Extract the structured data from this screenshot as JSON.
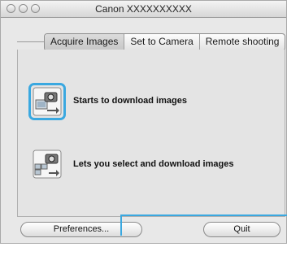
{
  "window": {
    "title": "Canon XXXXXXXXXX"
  },
  "tabs": [
    {
      "label": "Acquire Images",
      "active": true
    },
    {
      "label": "Set to Camera",
      "active": false
    },
    {
      "label": "Remote shooting",
      "active": false
    }
  ],
  "actions": [
    {
      "label": "Starts to download images",
      "icon": "camera-download-icon",
      "focused": true
    },
    {
      "label": "Lets you select and download images",
      "icon": "camera-select-download-icon",
      "focused": false
    }
  ],
  "buttons": {
    "preferences_label": "Preferences...",
    "quit_label": "Quit"
  },
  "colors": {
    "focus_ring": "#3aa8e0",
    "callout": "#3aa8e0"
  }
}
